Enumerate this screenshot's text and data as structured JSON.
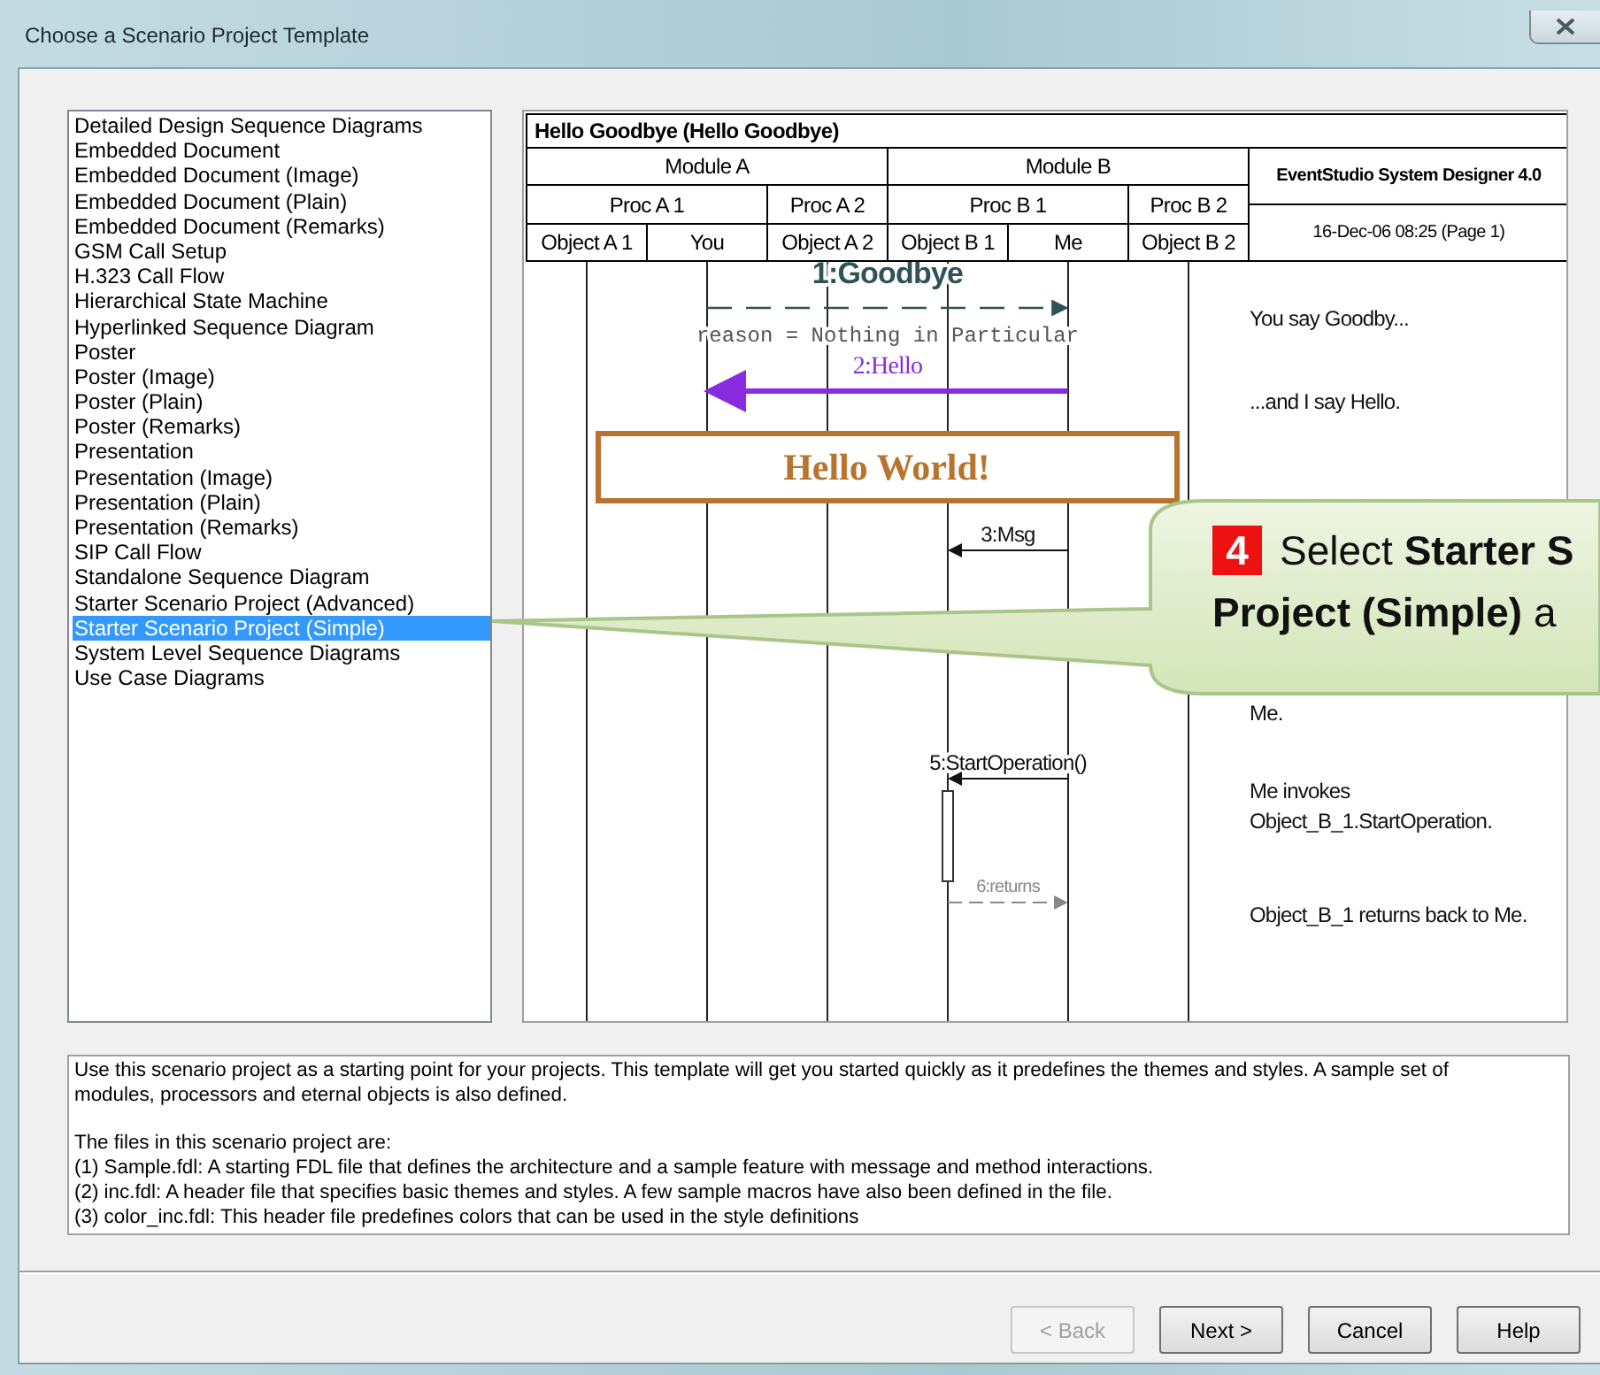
{
  "window": {
    "title": "Choose a Scenario Project Template"
  },
  "templates": [
    {
      "label": "Detailed Design Sequence Diagrams",
      "selected": false
    },
    {
      "label": "Embedded Document",
      "selected": false
    },
    {
      "label": "Embedded Document (Image)",
      "selected": false
    },
    {
      "label": "Embedded Document (Plain)",
      "selected": false
    },
    {
      "label": "Embedded Document (Remarks)",
      "selected": false
    },
    {
      "label": "GSM Call Setup",
      "selected": false
    },
    {
      "label": "H.323 Call Flow",
      "selected": false
    },
    {
      "label": "Hierarchical State Machine",
      "selected": false
    },
    {
      "label": "Hyperlinked Sequence Diagram",
      "selected": false
    },
    {
      "label": "Poster",
      "selected": false
    },
    {
      "label": "Poster (Image)",
      "selected": false
    },
    {
      "label": "Poster (Plain)",
      "selected": false
    },
    {
      "label": "Poster (Remarks)",
      "selected": false
    },
    {
      "label": "Presentation",
      "selected": false
    },
    {
      "label": "Presentation (Image)",
      "selected": false
    },
    {
      "label": "Presentation (Plain)",
      "selected": false
    },
    {
      "label": "Presentation (Remarks)",
      "selected": false
    },
    {
      "label": "SIP Call Flow",
      "selected": false
    },
    {
      "label": "Standalone Sequence Diagram",
      "selected": false
    },
    {
      "label": "Starter Scenario Project (Advanced)",
      "selected": false
    },
    {
      "label": "Starter Scenario Project (Simple)",
      "selected": true
    },
    {
      "label": "System Level Sequence Diagrams",
      "selected": false
    },
    {
      "label": "Use Case Diagrams",
      "selected": false
    }
  ],
  "preview": {
    "title": "Hello Goodbye (Hello Goodbye)",
    "modules": [
      {
        "name": "Module A",
        "processors": [
          {
            "name": "Proc A 1",
            "objects": [
              "Object A 1",
              "You"
            ]
          },
          {
            "name": "Proc A 2",
            "objects": [
              "Object A 2"
            ]
          }
        ]
      },
      {
        "name": "Module B",
        "processors": [
          {
            "name": "Proc B 1",
            "objects": [
              "Object B 1",
              "Me"
            ]
          },
          {
            "name": "Proc B 2",
            "objects": [
              "Object B 2"
            ]
          }
        ]
      }
    ],
    "tool": "EventStudio System Designer 4.0",
    "date": "16-Dec-06 08:25 (Page 1)",
    "events": [
      {
        "kind": "emphasis",
        "label": "1:Goodbye",
        "parameter": "reason = Nothing in Particular"
      },
      {
        "kind": "highlight",
        "label": "2:Hello"
      },
      {
        "kind": "action",
        "label": "Hello World!"
      },
      {
        "kind": "call",
        "label": "3:Msg"
      },
      {
        "kind": "call",
        "label": "5:StartOperation()"
      },
      {
        "kind": "activation"
      },
      {
        "kind": "return",
        "label": "6:returns"
      }
    ],
    "remarks": [
      {
        "lines": [
          "You say Goodby..."
        ]
      },
      {
        "lines": [
          "...and I say Hello."
        ]
      },
      {
        "lines": [
          "Me."
        ]
      },
      {
        "lines": [
          "Me invokes",
          "Object_B_1.StartOperation."
        ]
      },
      {
        "lines": [
          "Object_B_1 returns back to Me."
        ]
      }
    ]
  },
  "description": {
    "intro": "Use this scenario project as a starting point for your projects. This template will get you started quickly as it predefines the themes and styles. A sample set of modules, processors and eternal objects is also defined.",
    "files_heading": "The files in this scenario project are:",
    "files": [
      "(1) Sample.fdl: A starting FDL file that defines the architecture and a sample feature with message and method interactions.",
      "(2) inc.fdl: A header file that specifies basic themes and styles. A few sample macros have also been defined in the file.",
      "(3) color_inc.fdl: This header file predefines colors that can be used in the style definitions"
    ]
  },
  "buttons": [
    {
      "label": "< Back",
      "disabled": true
    },
    {
      "label": "Next >",
      "disabled": false
    },
    {
      "label": "Cancel",
      "disabled": false
    },
    {
      "label": "Help",
      "disabled": false
    }
  ],
  "callout": {
    "step": "4",
    "line_1": "Select **Starter S**",
    "line_2": "**Project (Simple)** a"
  }
}
